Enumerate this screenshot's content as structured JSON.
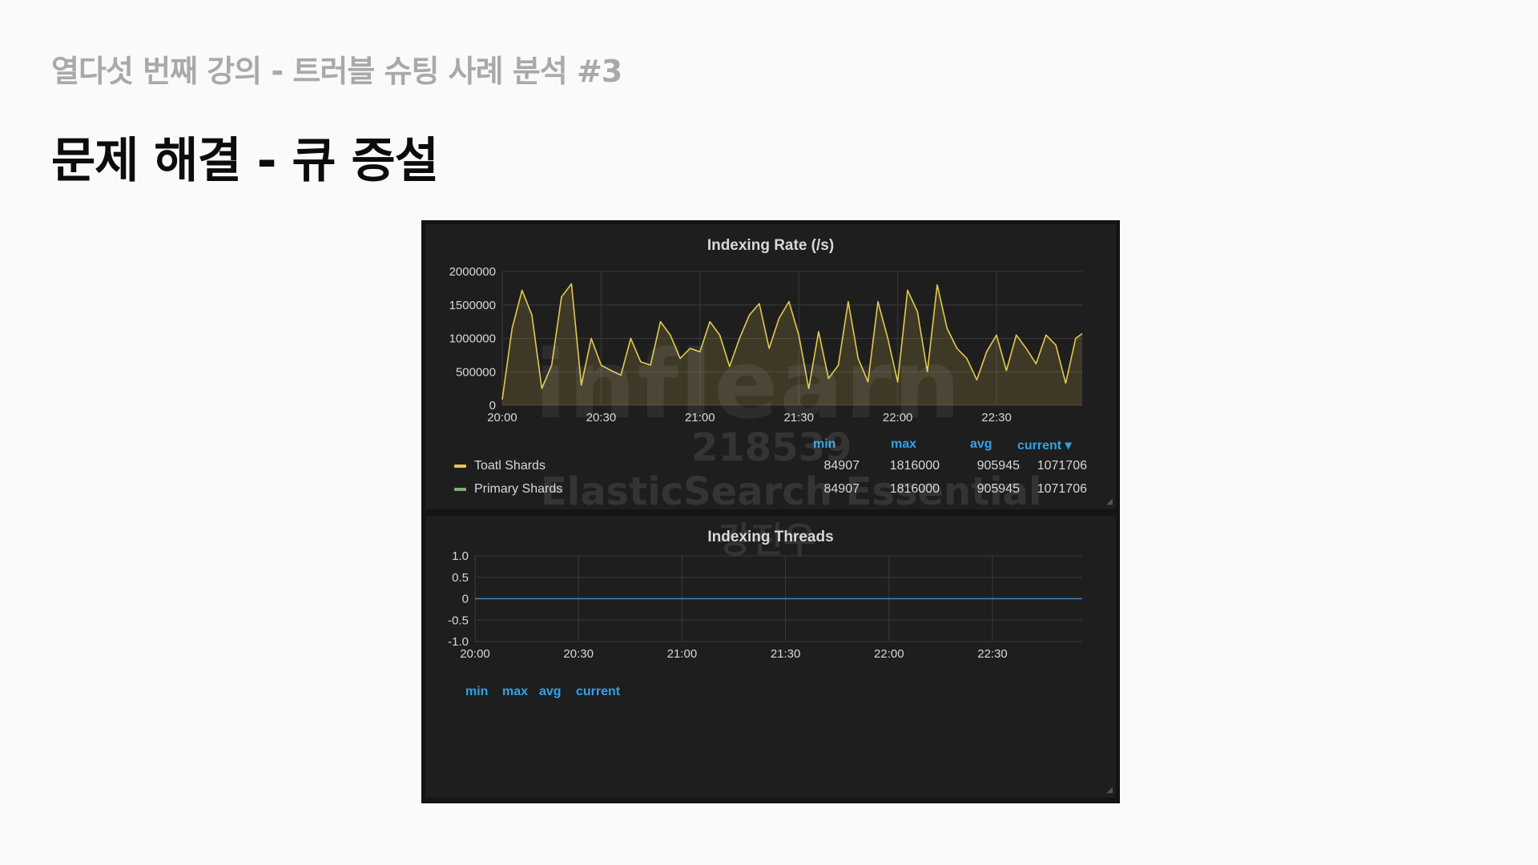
{
  "slide": {
    "subtitle": "열다섯 번째 강의 - 트러블 슈팅 사례 분석 #3",
    "title": "문제 해결 - 큐 증설"
  },
  "watermark": {
    "logo": "inflearn",
    "id": "218539",
    "course": "ElasticSearch Essential",
    "author": "강진우"
  },
  "colors": {
    "total": "#e5c94f",
    "primary": "#7eb26d",
    "legend_header": "#33a2e5",
    "threads": "#3b86c4"
  },
  "panel1": {
    "title": "Indexing Rate (/s)",
    "legend_headers": [
      "min",
      "max",
      "avg",
      "current ▾"
    ],
    "legend": [
      {
        "name": "Toatl Shards",
        "min": "84907",
        "max": "1816000",
        "avg": "905945",
        "current": "1071706"
      },
      {
        "name": "Primary Shards",
        "min": "84907",
        "max": "1816000",
        "avg": "905945",
        "current": "1071706"
      }
    ]
  },
  "panel2": {
    "title": "Indexing Threads",
    "legend_headers": [
      "min",
      "max",
      "avg",
      "current"
    ]
  },
  "chart_data": [
    {
      "type": "area",
      "title": "Indexing Rate (/s)",
      "x_ticks": [
        "20:00",
        "20:30",
        "21:00",
        "21:30",
        "22:00",
        "22:30"
      ],
      "y_ticks": [
        "0",
        "500000",
        "1000000",
        "1500000",
        "2000000"
      ],
      "ylim": [
        0,
        2000000
      ],
      "x_range_minutes": [
        0,
        176
      ],
      "grid": true,
      "series": [
        {
          "name": "Toatl Shards",
          "x_minutes": [
            0,
            3,
            6,
            9,
            12,
            15,
            18,
            21,
            24,
            27,
            30,
            33,
            36,
            39,
            42,
            45,
            48,
            51,
            54,
            57,
            60,
            63,
            66,
            69,
            72,
            75,
            78,
            81,
            84,
            87,
            90,
            93,
            96,
            99,
            102,
            105,
            108,
            111,
            114,
            117,
            120,
            123,
            126,
            129,
            132,
            135,
            138,
            141,
            144,
            147,
            150,
            153,
            156,
            159,
            162,
            165,
            168,
            171,
            174,
            176
          ],
          "values": [
            84907,
            1150000,
            1720000,
            1350000,
            250000,
            600000,
            1620000,
            1816000,
            300000,
            1000000,
            600000,
            520000,
            450000,
            1000000,
            650000,
            600000,
            1250000,
            1050000,
            700000,
            850000,
            800000,
            1250000,
            1050000,
            580000,
            1000000,
            1350000,
            1520000,
            850000,
            1300000,
            1550000,
            1050000,
            250000,
            1100000,
            400000,
            600000,
            1550000,
            700000,
            350000,
            1550000,
            1000000,
            350000,
            1720000,
            1400000,
            500000,
            1800000,
            1150000,
            850000,
            700000,
            380000,
            800000,
            1050000,
            520000,
            1050000,
            850000,
            620000,
            1050000,
            900000,
            330000,
            1000000,
            1071706
          ]
        },
        {
          "name": "Primary Shards",
          "x_minutes": [],
          "values": []
        }
      ]
    },
    {
      "type": "line",
      "title": "Indexing Threads",
      "x_ticks": [
        "20:00",
        "20:30",
        "21:00",
        "21:30",
        "22:00",
        "22:30"
      ],
      "y_ticks": [
        "1.0",
        "0.5",
        "0",
        "-0.5",
        "-1.0"
      ],
      "ylim": [
        -1,
        1
      ],
      "grid": true,
      "series": [
        {
          "name": "",
          "x_minutes": [
            0,
            176
          ],
          "values": [
            0,
            0
          ]
        }
      ]
    }
  ]
}
